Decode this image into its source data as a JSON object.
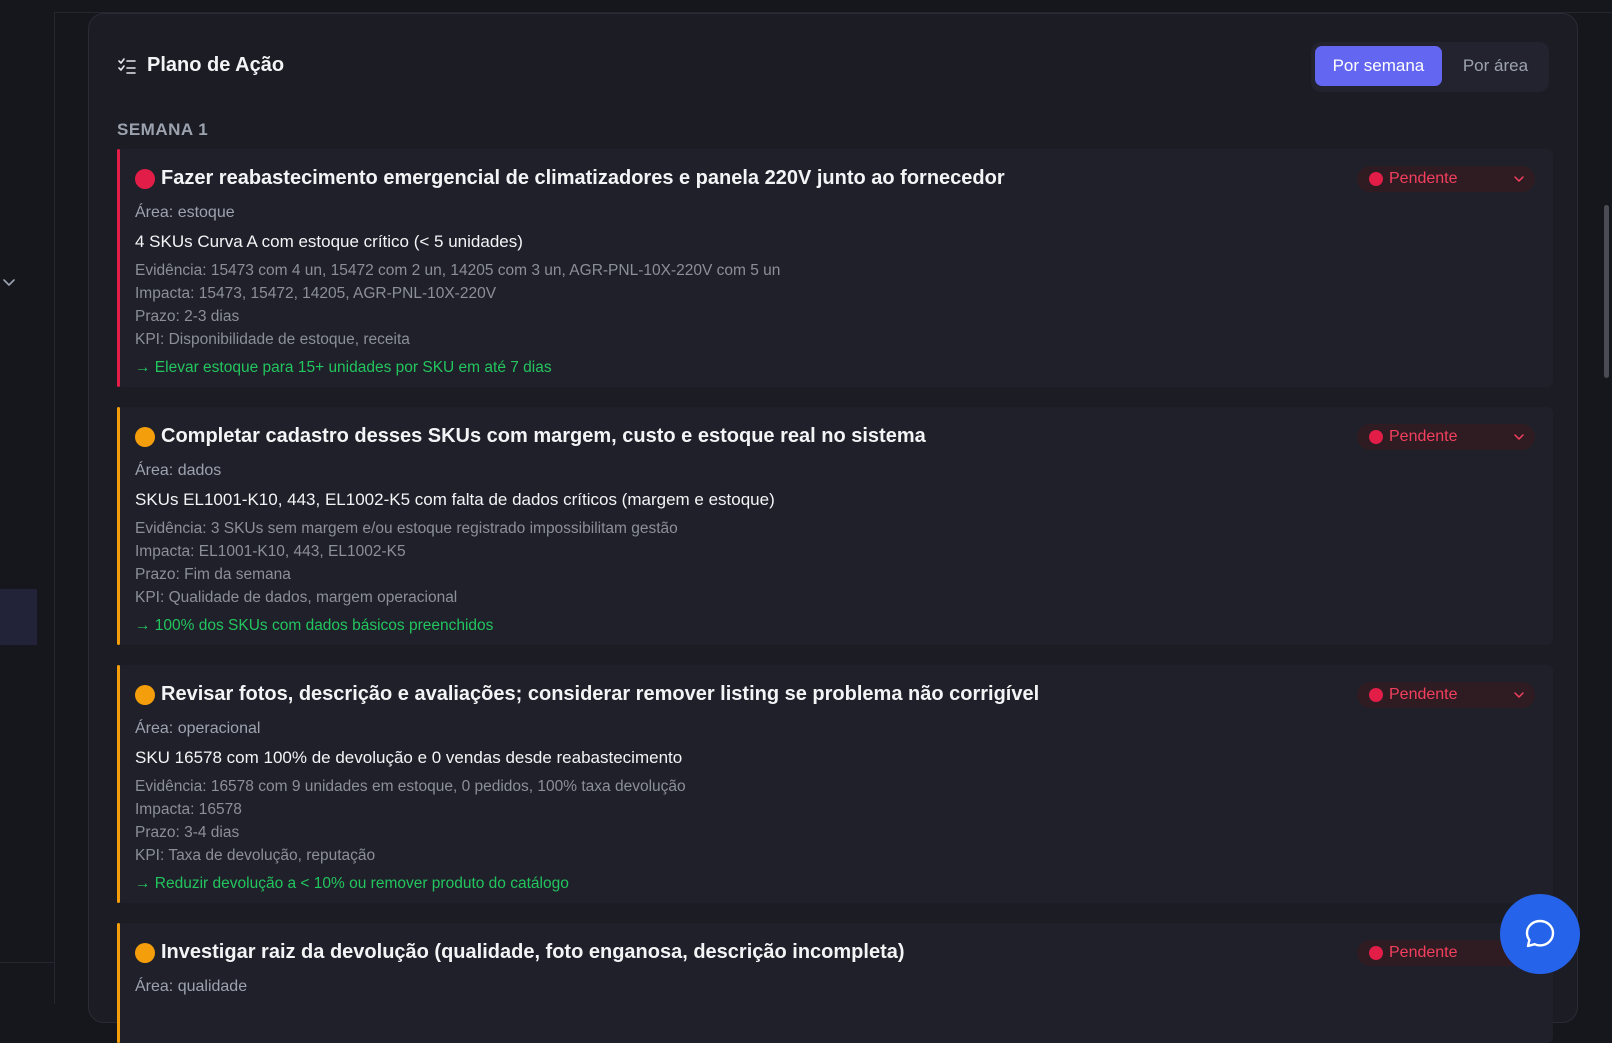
{
  "panel": {
    "title": "Plano de Ação",
    "icon": "list-check-icon",
    "view_toggle": {
      "active": "Por semana",
      "inactive": "Por área"
    },
    "week_label": "SEMANA 1"
  },
  "colors": {
    "accent": "#6366f1",
    "priority_high": "#e11d48",
    "priority_medium": "#f59e0b",
    "goal_text": "#22c55e",
    "status_pending": "#f43f5e",
    "chat_button": "#2563eb"
  },
  "actions": [
    {
      "title": "Fazer reabastecimento emergencial de climatizadores e panela 220V junto ao fornecedor",
      "priority_color": "#e11d48",
      "area": "Área: estoque",
      "description": "4 SKUs Curva A com estoque crítico (< 5 unidades)",
      "evidence": "Evidência: 15473 com 4 un, 15472 com 2 un, 14205 com 3 un, AGR-PNL-10X-220V com 5 un",
      "impacts": "Impacta: 15473, 15472, 14205, AGR-PNL-10X-220V",
      "deadline": "Prazo: 2-3 dias",
      "kpi": "KPI: Disponibilidade de estoque, receita",
      "goal": "→ Elevar estoque para 15+ unidades por SKU em até 7 dias",
      "status": "Pendente"
    },
    {
      "title": "Completar cadastro desses SKUs com margem, custo e estoque real no sistema",
      "priority_color": "#f59e0b",
      "area": "Área: dados",
      "description": "SKUs EL1001-K10, 443, EL1002-K5 com falta de dados críticos (margem e estoque)",
      "evidence": "Evidência: 3 SKUs sem margem e/ou estoque registrado impossibilitam gestão",
      "impacts": "Impacta: EL1001-K10, 443, EL1002-K5",
      "deadline": "Prazo: Fim da semana",
      "kpi": "KPI: Qualidade de dados, margem operacional",
      "goal": "→ 100% dos SKUs com dados básicos preenchidos",
      "status": "Pendente"
    },
    {
      "title": "Revisar fotos, descrição e avaliações; considerar remover listing se problema não corrigível",
      "priority_color": "#f59e0b",
      "area": "Área: operacional",
      "description": "SKU 16578 com 100% de devolução e 0 vendas desde reabastecimento",
      "evidence": "Evidência: 16578 com 9 unidades em estoque, 0 pedidos, 100% taxa devolução",
      "impacts": "Impacta: 16578",
      "deadline": "Prazo: 3-4 dias",
      "kpi": "KPI: Taxa de devolução, reputação",
      "goal": "→ Reduzir devolução a < 10% ou remover produto do catálogo",
      "status": "Pendente"
    },
    {
      "title": "Investigar raiz da devolução (qualidade, foto enganosa, descrição incompleta)",
      "priority_color": "#f59e0b",
      "area": "Área: qualidade",
      "status": "Pendente"
    }
  ]
}
